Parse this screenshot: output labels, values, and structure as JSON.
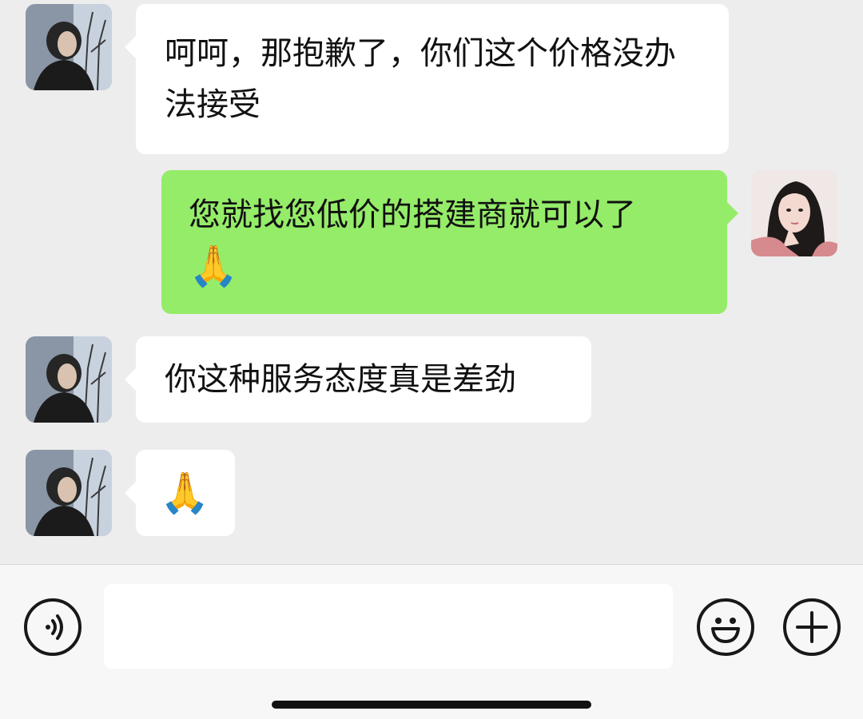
{
  "messages": [
    {
      "side": "in",
      "text": "呵呵，那抱歉了，你们这个价格没办法接受"
    },
    {
      "side": "out",
      "text": "您就找您低价的搭建商就可以了",
      "emoji": "🙏"
    },
    {
      "side": "in",
      "text": "你这种服务态度真是差劲"
    },
    {
      "side": "in",
      "emoji": "🙏"
    }
  ],
  "input": {
    "value": "",
    "placeholder": ""
  },
  "icons": {
    "voice": "voice-icon",
    "emoji": "smiley-icon",
    "more": "plus-icon"
  },
  "colors": {
    "chat_background": "#ededed",
    "incoming_bubble": "#ffffff",
    "outgoing_bubble": "#95ec69",
    "input_bar": "#f7f7f7"
  }
}
